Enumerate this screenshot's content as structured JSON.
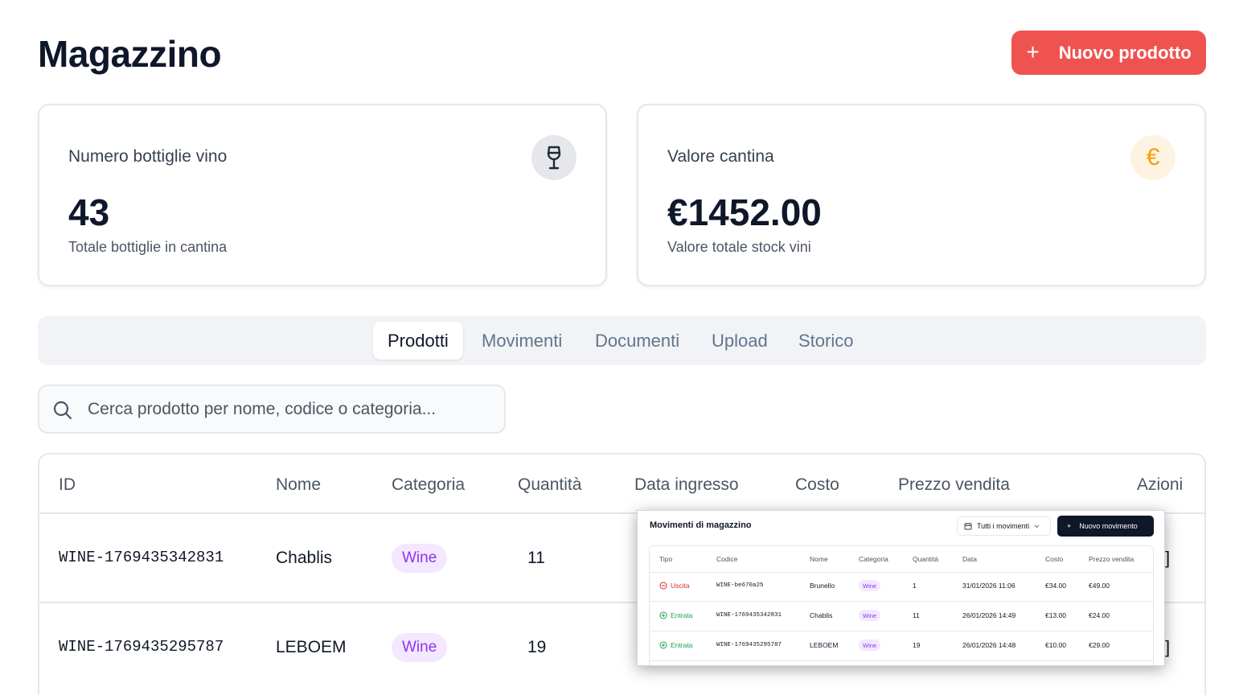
{
  "page": {
    "title": "Magazzino"
  },
  "header": {
    "new_product_label": "Nuovo prodotto",
    "new_product_icon": "plus-icon"
  },
  "stats": {
    "bottles": {
      "label": "Numero bottiglie vino",
      "value": "43",
      "subtitle": "Totale bottiglie in cantina",
      "icon": "wine-glass-icon"
    },
    "value": {
      "label": "Valore cantina",
      "value": "€1452.00",
      "subtitle": "Valore totale stock vini",
      "icon": "euro-icon",
      "icon_glyph": "€"
    }
  },
  "tabs": [
    {
      "label": "Prodotti",
      "active": true
    },
    {
      "label": "Movimenti",
      "active": false
    },
    {
      "label": "Documenti",
      "active": false
    },
    {
      "label": "Upload",
      "active": false
    },
    {
      "label": "Storico",
      "active": false
    }
  ],
  "search": {
    "placeholder": "Cerca prodotto per nome, codice o categoria...",
    "value": ""
  },
  "products_table": {
    "columns": [
      "ID",
      "Nome",
      "Categoria",
      "Quantità",
      "Data ingresso",
      "Costo",
      "Prezzo vendita",
      "Azioni"
    ],
    "rows": [
      {
        "id": "WINE-1769435342831",
        "name": "Chablis",
        "category": "Wine",
        "quantity": "11"
      },
      {
        "id": "WINE-1769435295787",
        "name": "LEBOEM",
        "category": "Wine",
        "quantity": "19"
      }
    ]
  },
  "movements_overlay": {
    "title": "Movimenti di magazzino",
    "filter_label": "Tutti i movimenti",
    "new_button_label": "Nuovo movimento",
    "columns": [
      "Tipo",
      "Codice",
      "Nome",
      "Categoria",
      "Quantità",
      "Data",
      "Costo",
      "Prezzo vendita"
    ],
    "rows": [
      {
        "type": "Uscita",
        "code": "WINE-be670a25",
        "name": "Brunello",
        "category": "Wine",
        "quantity": "1",
        "date": "31/01/2026 11:06",
        "cost": "€34.00",
        "price": "€49.00"
      },
      {
        "type": "Entrata",
        "code": "WINE-1769435342831",
        "name": "Chablis",
        "category": "Wine",
        "quantity": "11",
        "date": "26/01/2026 14:49",
        "cost": "€13.00",
        "price": "€24.00"
      },
      {
        "type": "Entrata",
        "code": "WINE-1769435295787",
        "name": "LEBOEM",
        "category": "Wine",
        "quantity": "19",
        "date": "26/01/2026 14:48",
        "cost": "€10.00",
        "price": "€29.00"
      }
    ]
  },
  "colors": {
    "accent": "#ef5350",
    "wine_pill_bg": "#f3e8ff",
    "wine_pill_text": "#9333ea",
    "euro_icon": "#f59e0b",
    "exit": "#dc2626",
    "entry": "#16a34a"
  }
}
